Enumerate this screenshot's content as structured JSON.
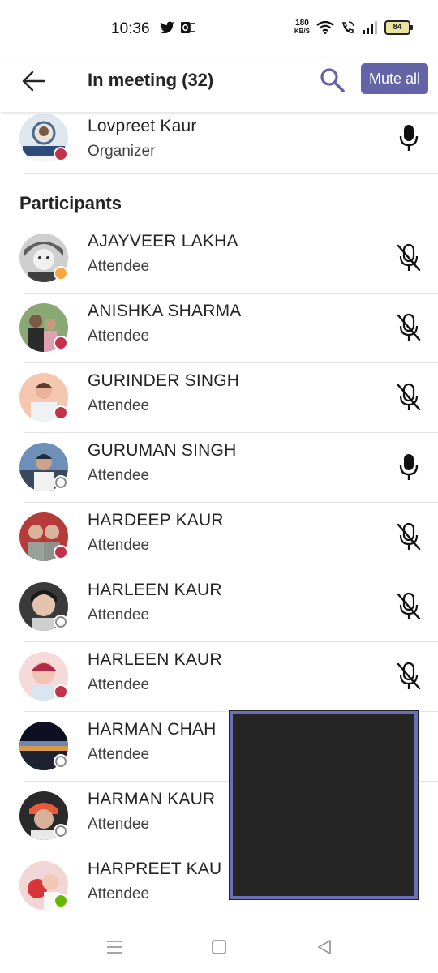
{
  "status_bar": {
    "time": "10:36",
    "net_speed_value": "180",
    "net_speed_unit": "KB/S",
    "battery": "84",
    "icons": [
      "twitter-icon",
      "outlook-icon",
      "wifi-icon",
      "wifi-call-icon",
      "signal-icon",
      "battery-icon"
    ]
  },
  "header": {
    "title": "In meeting (32)",
    "mute_all_label": "Mute all",
    "back_icon": "arrow-left-icon",
    "search_icon": "search-icon"
  },
  "colors": {
    "accent": "#6264a7",
    "busy": "#c4314b",
    "away": "#f8a740",
    "available": "#6bb700",
    "offline": "#8a8a8a"
  },
  "organizer": {
    "name": "Lovpreet Kaur",
    "role": "Organizer",
    "presence": "busy",
    "mic": "unmuted"
  },
  "participants_label": "Participants",
  "participants": [
    {
      "name": "AJAYVEER LAKHA",
      "role": "Attendee",
      "presence": "away",
      "mic": "muted"
    },
    {
      "name": "ANISHKA SHARMA",
      "role": "Attendee",
      "presence": "busy",
      "mic": "muted"
    },
    {
      "name": "GURINDER SINGH",
      "role": "Attendee",
      "presence": "busy",
      "mic": "muted"
    },
    {
      "name": "GURUMAN SINGH",
      "role": "Attendee",
      "presence": "offline",
      "mic": "unmuted"
    },
    {
      "name": "HARDEEP KAUR",
      "role": "Attendee",
      "presence": "busy",
      "mic": "muted"
    },
    {
      "name": "HARLEEN KAUR",
      "role": "Attendee",
      "presence": "offline",
      "mic": "muted"
    },
    {
      "name": "HARLEEN KAUR",
      "role": "Attendee",
      "presence": "busy",
      "mic": "muted"
    },
    {
      "name": "HARMAN CHAH",
      "role": "Attendee",
      "presence": "offline",
      "mic": "muted"
    },
    {
      "name": "HARMAN KAUR",
      "role": "Attendee",
      "presence": "offline",
      "mic": "muted"
    },
    {
      "name": "HARPREET KAU",
      "role": "Attendee",
      "presence": "available",
      "mic": "muted"
    }
  ],
  "nav_bar": {
    "icons": [
      "menu-icon",
      "home-icon",
      "back-triangle-icon"
    ]
  }
}
